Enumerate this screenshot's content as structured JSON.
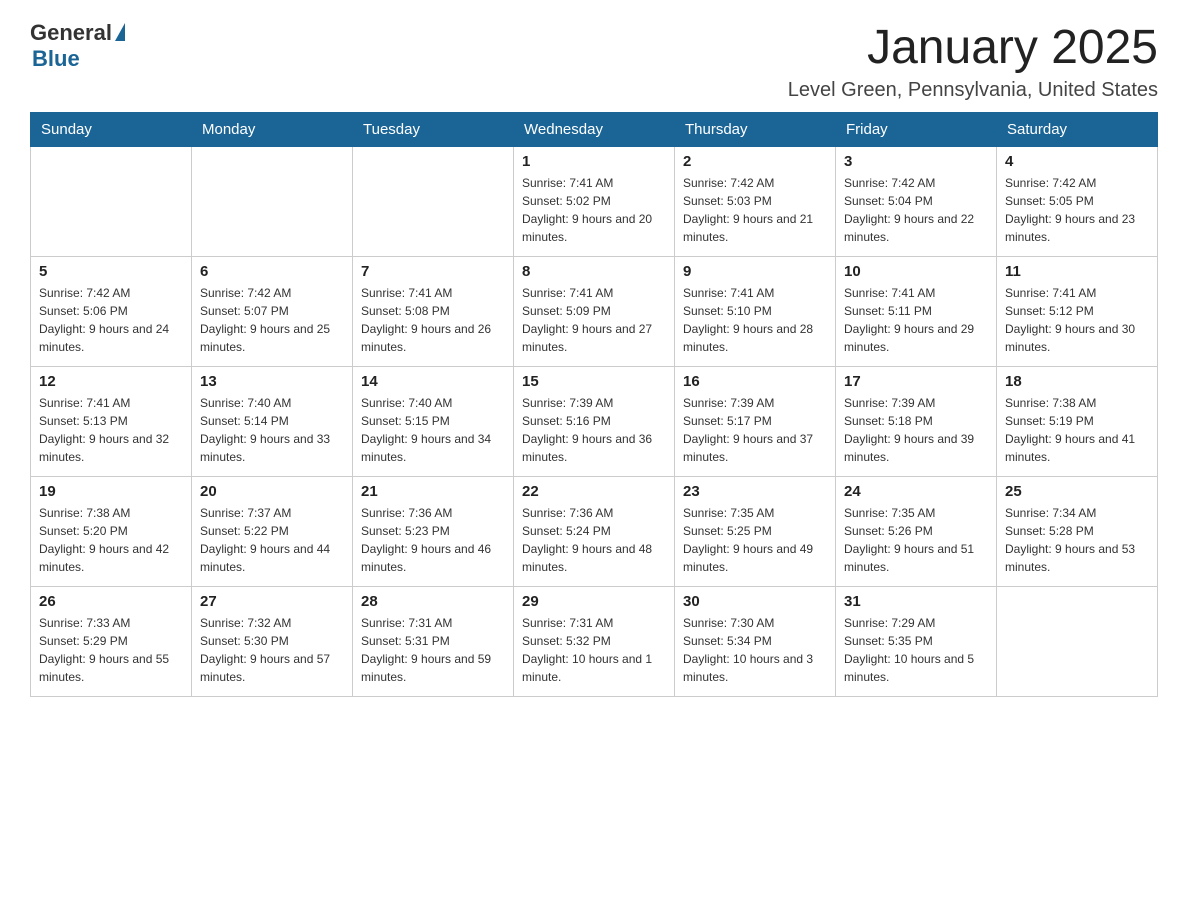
{
  "header": {
    "logo_general": "General",
    "logo_blue": "Blue",
    "month_title": "January 2025",
    "location": "Level Green, Pennsylvania, United States"
  },
  "weekdays": [
    "Sunday",
    "Monday",
    "Tuesday",
    "Wednesday",
    "Thursday",
    "Friday",
    "Saturday"
  ],
  "weeks": [
    [
      {
        "day": "",
        "sunrise": "",
        "sunset": "",
        "daylight": ""
      },
      {
        "day": "",
        "sunrise": "",
        "sunset": "",
        "daylight": ""
      },
      {
        "day": "",
        "sunrise": "",
        "sunset": "",
        "daylight": ""
      },
      {
        "day": "1",
        "sunrise": "Sunrise: 7:41 AM",
        "sunset": "Sunset: 5:02 PM",
        "daylight": "Daylight: 9 hours and 20 minutes."
      },
      {
        "day": "2",
        "sunrise": "Sunrise: 7:42 AM",
        "sunset": "Sunset: 5:03 PM",
        "daylight": "Daylight: 9 hours and 21 minutes."
      },
      {
        "day": "3",
        "sunrise": "Sunrise: 7:42 AM",
        "sunset": "Sunset: 5:04 PM",
        "daylight": "Daylight: 9 hours and 22 minutes."
      },
      {
        "day": "4",
        "sunrise": "Sunrise: 7:42 AM",
        "sunset": "Sunset: 5:05 PM",
        "daylight": "Daylight: 9 hours and 23 minutes."
      }
    ],
    [
      {
        "day": "5",
        "sunrise": "Sunrise: 7:42 AM",
        "sunset": "Sunset: 5:06 PM",
        "daylight": "Daylight: 9 hours and 24 minutes."
      },
      {
        "day": "6",
        "sunrise": "Sunrise: 7:42 AM",
        "sunset": "Sunset: 5:07 PM",
        "daylight": "Daylight: 9 hours and 25 minutes."
      },
      {
        "day": "7",
        "sunrise": "Sunrise: 7:41 AM",
        "sunset": "Sunset: 5:08 PM",
        "daylight": "Daylight: 9 hours and 26 minutes."
      },
      {
        "day": "8",
        "sunrise": "Sunrise: 7:41 AM",
        "sunset": "Sunset: 5:09 PM",
        "daylight": "Daylight: 9 hours and 27 minutes."
      },
      {
        "day": "9",
        "sunrise": "Sunrise: 7:41 AM",
        "sunset": "Sunset: 5:10 PM",
        "daylight": "Daylight: 9 hours and 28 minutes."
      },
      {
        "day": "10",
        "sunrise": "Sunrise: 7:41 AM",
        "sunset": "Sunset: 5:11 PM",
        "daylight": "Daylight: 9 hours and 29 minutes."
      },
      {
        "day": "11",
        "sunrise": "Sunrise: 7:41 AM",
        "sunset": "Sunset: 5:12 PM",
        "daylight": "Daylight: 9 hours and 30 minutes."
      }
    ],
    [
      {
        "day": "12",
        "sunrise": "Sunrise: 7:41 AM",
        "sunset": "Sunset: 5:13 PM",
        "daylight": "Daylight: 9 hours and 32 minutes."
      },
      {
        "day": "13",
        "sunrise": "Sunrise: 7:40 AM",
        "sunset": "Sunset: 5:14 PM",
        "daylight": "Daylight: 9 hours and 33 minutes."
      },
      {
        "day": "14",
        "sunrise": "Sunrise: 7:40 AM",
        "sunset": "Sunset: 5:15 PM",
        "daylight": "Daylight: 9 hours and 34 minutes."
      },
      {
        "day": "15",
        "sunrise": "Sunrise: 7:39 AM",
        "sunset": "Sunset: 5:16 PM",
        "daylight": "Daylight: 9 hours and 36 minutes."
      },
      {
        "day": "16",
        "sunrise": "Sunrise: 7:39 AM",
        "sunset": "Sunset: 5:17 PM",
        "daylight": "Daylight: 9 hours and 37 minutes."
      },
      {
        "day": "17",
        "sunrise": "Sunrise: 7:39 AM",
        "sunset": "Sunset: 5:18 PM",
        "daylight": "Daylight: 9 hours and 39 minutes."
      },
      {
        "day": "18",
        "sunrise": "Sunrise: 7:38 AM",
        "sunset": "Sunset: 5:19 PM",
        "daylight": "Daylight: 9 hours and 41 minutes."
      }
    ],
    [
      {
        "day": "19",
        "sunrise": "Sunrise: 7:38 AM",
        "sunset": "Sunset: 5:20 PM",
        "daylight": "Daylight: 9 hours and 42 minutes."
      },
      {
        "day": "20",
        "sunrise": "Sunrise: 7:37 AM",
        "sunset": "Sunset: 5:22 PM",
        "daylight": "Daylight: 9 hours and 44 minutes."
      },
      {
        "day": "21",
        "sunrise": "Sunrise: 7:36 AM",
        "sunset": "Sunset: 5:23 PM",
        "daylight": "Daylight: 9 hours and 46 minutes."
      },
      {
        "day": "22",
        "sunrise": "Sunrise: 7:36 AM",
        "sunset": "Sunset: 5:24 PM",
        "daylight": "Daylight: 9 hours and 48 minutes."
      },
      {
        "day": "23",
        "sunrise": "Sunrise: 7:35 AM",
        "sunset": "Sunset: 5:25 PM",
        "daylight": "Daylight: 9 hours and 49 minutes."
      },
      {
        "day": "24",
        "sunrise": "Sunrise: 7:35 AM",
        "sunset": "Sunset: 5:26 PM",
        "daylight": "Daylight: 9 hours and 51 minutes."
      },
      {
        "day": "25",
        "sunrise": "Sunrise: 7:34 AM",
        "sunset": "Sunset: 5:28 PM",
        "daylight": "Daylight: 9 hours and 53 minutes."
      }
    ],
    [
      {
        "day": "26",
        "sunrise": "Sunrise: 7:33 AM",
        "sunset": "Sunset: 5:29 PM",
        "daylight": "Daylight: 9 hours and 55 minutes."
      },
      {
        "day": "27",
        "sunrise": "Sunrise: 7:32 AM",
        "sunset": "Sunset: 5:30 PM",
        "daylight": "Daylight: 9 hours and 57 minutes."
      },
      {
        "day": "28",
        "sunrise": "Sunrise: 7:31 AM",
        "sunset": "Sunset: 5:31 PM",
        "daylight": "Daylight: 9 hours and 59 minutes."
      },
      {
        "day": "29",
        "sunrise": "Sunrise: 7:31 AM",
        "sunset": "Sunset: 5:32 PM",
        "daylight": "Daylight: 10 hours and 1 minute."
      },
      {
        "day": "30",
        "sunrise": "Sunrise: 7:30 AM",
        "sunset": "Sunset: 5:34 PM",
        "daylight": "Daylight: 10 hours and 3 minutes."
      },
      {
        "day": "31",
        "sunrise": "Sunrise: 7:29 AM",
        "sunset": "Sunset: 5:35 PM",
        "daylight": "Daylight: 10 hours and 5 minutes."
      },
      {
        "day": "",
        "sunrise": "",
        "sunset": "",
        "daylight": ""
      }
    ]
  ]
}
